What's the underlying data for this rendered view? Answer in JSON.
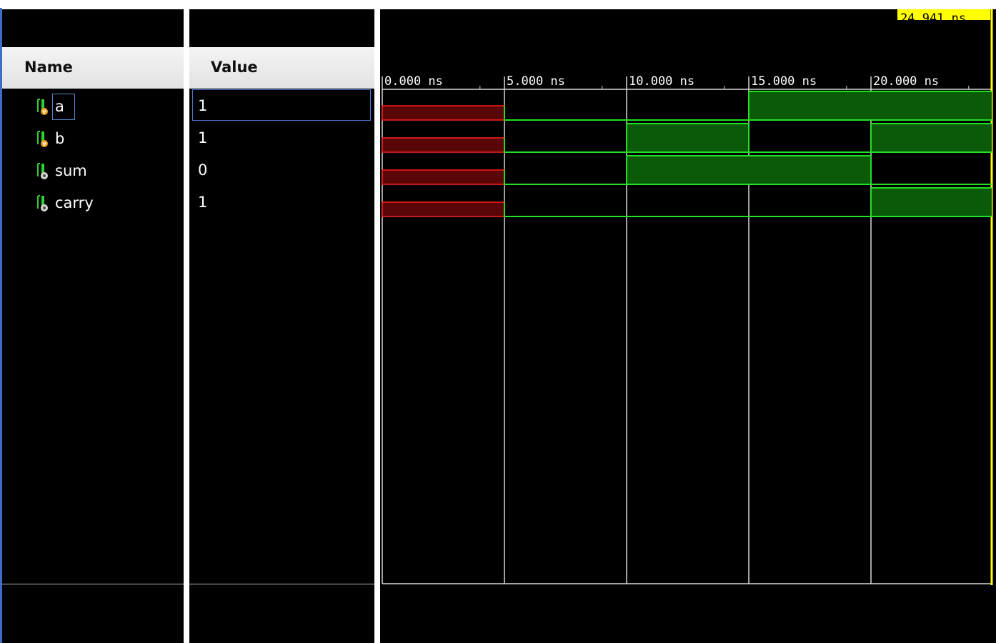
{
  "columns": {
    "name_header": "Name",
    "value_header": "Value"
  },
  "signals": [
    {
      "name": "a",
      "value": "1",
      "kind": "input",
      "selected": true
    },
    {
      "name": "b",
      "value": "1",
      "kind": "input",
      "selected": false
    },
    {
      "name": "sum",
      "value": "0",
      "kind": "output",
      "selected": false
    },
    {
      "name": "carry",
      "value": "1",
      "kind": "output",
      "selected": false
    }
  ],
  "timeline": {
    "unit": "ns",
    "ticks": [
      "0.000 ns",
      "5.000 ns",
      "10.000 ns",
      "15.000 ns",
      "20.000 ns"
    ],
    "cursor_label": "24.941 ns",
    "cursor_time_ns": 24.941,
    "view_end_ns": 25
  },
  "waveforms": {
    "segments_ns": [
      0,
      5,
      10,
      15,
      20,
      25
    ],
    "values": {
      "a": [
        "X",
        "0",
        "0",
        "1",
        "1"
      ],
      "b": [
        "X",
        "0",
        "1",
        "0",
        "1"
      ],
      "sum": [
        "X",
        "0",
        "1",
        "1",
        "0"
      ],
      "carry": [
        "X",
        "0",
        "0",
        "0",
        "1"
      ]
    }
  },
  "colors": {
    "background": "#000000",
    "wave_green": "#22e022",
    "wave_high_fill": "#0a5a0a",
    "undefined_red": "#ff2020",
    "undefined_fill": "#5a0606",
    "grid": "#d8d8d8",
    "cursor": "#ffff00",
    "selection_border": "#4a7bd0"
  }
}
